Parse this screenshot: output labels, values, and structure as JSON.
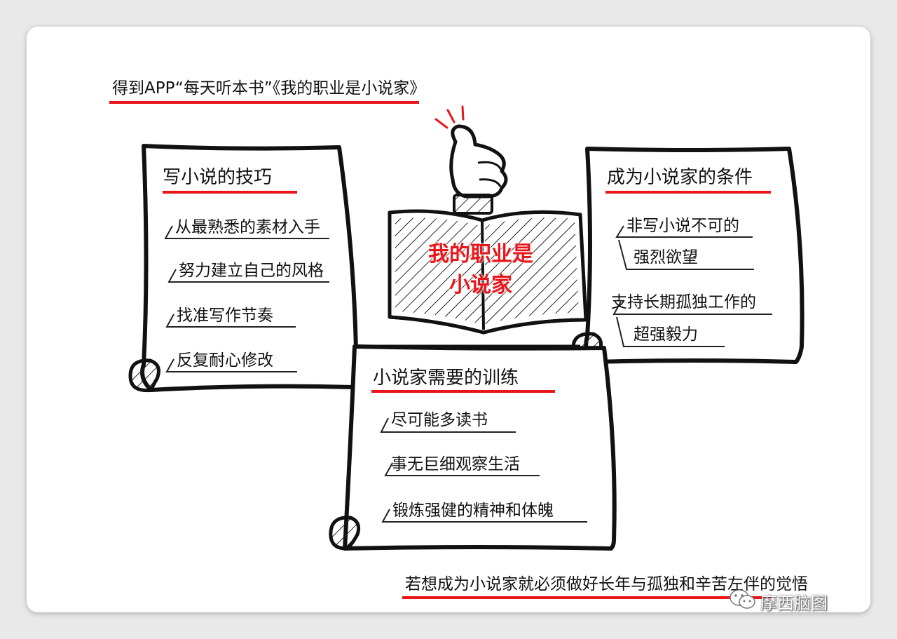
{
  "header": {
    "source_line": "得到APP“每天听本书”《我的职业是小说家》"
  },
  "center_book": {
    "title_line1": "我的职业是",
    "title_line2": "小说家"
  },
  "left_scroll": {
    "heading": "写小说的技巧",
    "items": [
      "从最熟悉的素材入手",
      "努力建立自己的风格",
      "找准写作节奏",
      "反复耐心修改"
    ]
  },
  "right_scroll": {
    "heading": "成为小说家的条件",
    "items": [
      {
        "line1": "非写小说不可的",
        "line2": "强烈欲望"
      },
      {
        "line1": "支持长期孤独工作的",
        "line2": "超强毅力"
      }
    ]
  },
  "bottom_scroll": {
    "heading": "小说家需要的训练",
    "items": [
      "尽可能多读书",
      "事无巨细观察生活",
      "锻炼强健的精神和体魄"
    ]
  },
  "footer": {
    "conclusion": "若想成为小说家就必须做好长年与孤独和辛苦左伴的觉悟"
  },
  "watermark": {
    "text": "摩西脑图",
    "icon": "wechat-icon"
  },
  "colors": {
    "accent_red": "#e8161b",
    "ink": "#111111"
  }
}
